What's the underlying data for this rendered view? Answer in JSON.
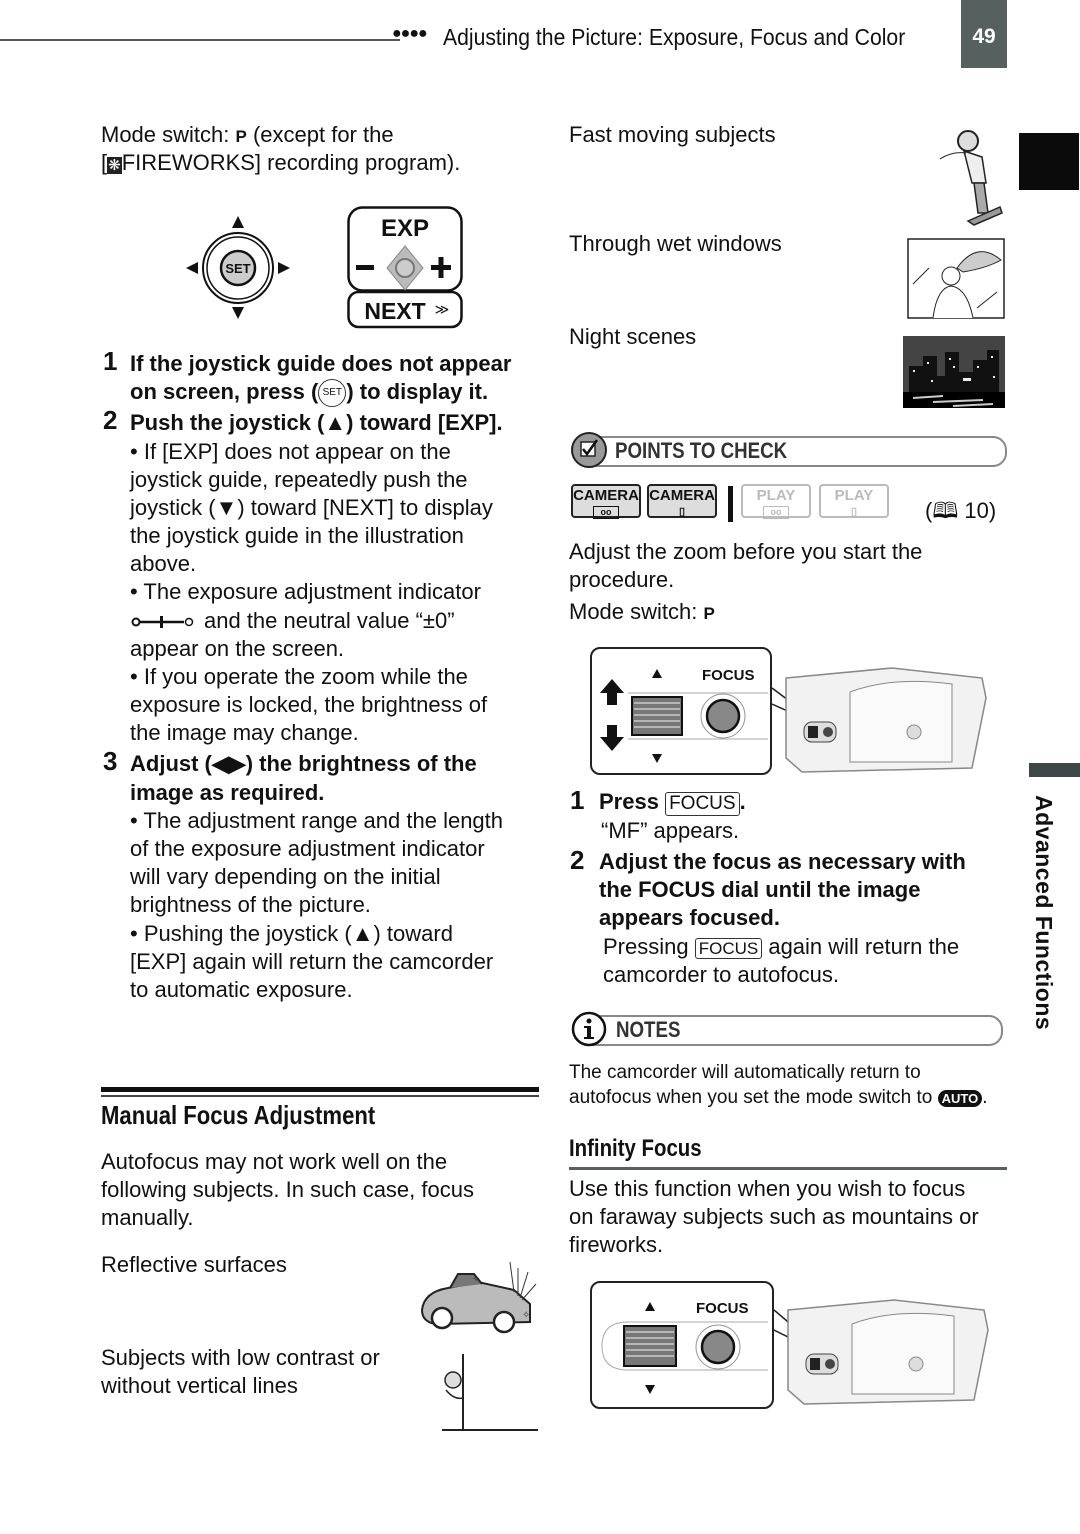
{
  "header": {
    "dots": "●●●●",
    "section_title": "Adjusting the Picture: Exposure, Focus and Color",
    "page_number": "49"
  },
  "side_tab": {
    "label": "Advanced Functions"
  },
  "left": {
    "mode_line1_prefix": "Mode switch: ",
    "mode_symbol": "P",
    "mode_line1_suffix": " (except for the",
    "mode_line2_prefix": "[",
    "fireworks_icon": "❋",
    "mode_line2_suffix": "FIREWORKS] recording program).",
    "joystick": {
      "center": "SET",
      "exp": "EXP",
      "minus": "−",
      "plus": "+",
      "next": "NEXT",
      "next_glyph": "≫"
    },
    "steps": [
      {
        "num": "1",
        "line1": "If the joystick guide does not appear",
        "line2_a": "on screen, press (",
        "set": "SET",
        "line2_b": ") to display it."
      },
      {
        "num": "2",
        "line1": "Push the joystick (▲) toward [EXP]."
      },
      {
        "num": "3",
        "line1": "Adjust (◀▶) the brightness of the",
        "line2": "image as required."
      }
    ],
    "step2_bullets": [
      [
        "If [EXP] does not appear on the",
        "joystick guide, repeatedly push the",
        "joystick (▼) toward [NEXT] to display",
        "the joystick guide in the illustration",
        "above."
      ],
      [
        "The exposure adjustment indicator",
        "and the neutral value “±0”",
        "appear on the screen."
      ],
      [
        "If you operate the zoom while the",
        "exposure is locked, the brightness of",
        "the image may change."
      ]
    ],
    "exposure_indicator": "o—I—o",
    "step3_bullets": [
      [
        "The adjustment range and the length",
        "of the exposure adjustment indicator",
        "will vary depending on the initial",
        "brightness of the picture."
      ],
      [
        "Pushing the joystick (▲) toward",
        "[EXP] again will return the camcorder",
        "to automatic exposure."
      ]
    ],
    "manual_focus": {
      "title": "Manual Focus Adjustment",
      "intro": [
        "Autofocus may not work well on the",
        "following subjects. In such case, focus",
        "manually."
      ],
      "subjects": [
        "Reflective surfaces",
        "Subjects with low contrast or",
        "without vertical lines"
      ]
    }
  },
  "right": {
    "subjects": [
      "Fast moving subjects",
      "Through wet windows",
      "Night scenes"
    ],
    "points_to_check": {
      "label": "POINTS TO CHECK",
      "modes": [
        {
          "label": "CAMERA",
          "glyph": "oo",
          "active": true
        },
        {
          "label": "CAMERA",
          "glyph": "▯",
          "active": true
        },
        {
          "label": "PLAY",
          "glyph": "oo",
          "active": false
        },
        {
          "label": "PLAY",
          "glyph": "▯",
          "active": false
        }
      ],
      "page_ref": "(🕮 10)",
      "text": [
        "Adjust the zoom before you start the",
        "procedure."
      ],
      "mode_prefix": "Mode switch: ",
      "mode_symbol": "P"
    },
    "focus_label": "FOCUS",
    "steps": [
      {
        "num": "1",
        "press": "Press ",
        "key": "FOCUS",
        "dot": ".",
        "sub": "“MF” appears."
      },
      {
        "num": "2",
        "lines": [
          "Adjust the focus as necessary with",
          "the FOCUS dial until the image",
          "appears focused."
        ],
        "sub_a": "Pressing ",
        "key": "FOCUS",
        "sub_b": " again will return the",
        "sub2": "camcorder to autofocus."
      }
    ],
    "notes": {
      "label": "NOTES",
      "line1": "The camcorder will automatically return to",
      "line2": "autofocus when you set the mode switch to ",
      "auto": "AUTO",
      "end": "."
    },
    "infinity": {
      "title": "Infinity Focus",
      "text": [
        "Use this function when you wish to focus",
        "on faraway subjects such as mountains or",
        "fireworks."
      ]
    }
  }
}
